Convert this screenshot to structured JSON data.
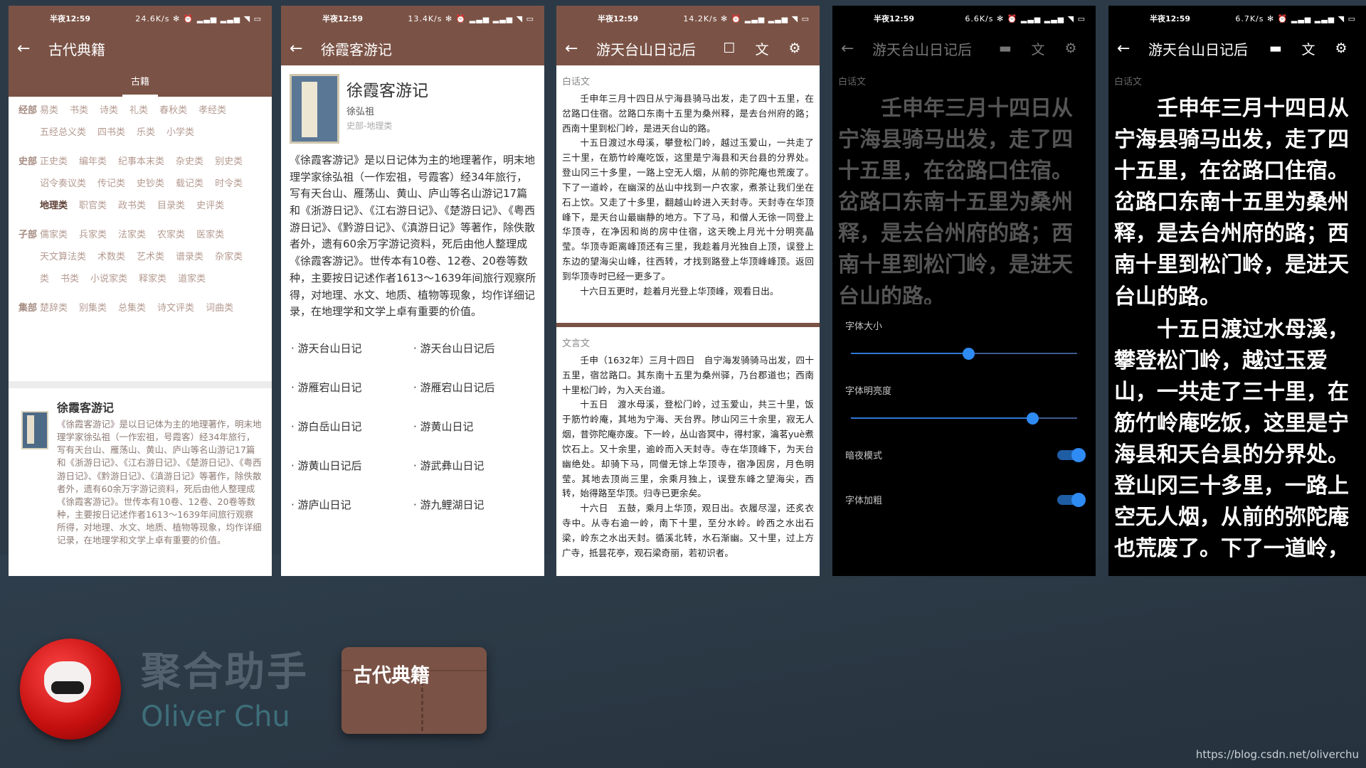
{
  "status": {
    "time": "半夜12:59",
    "p1_speed": "24.6K/s",
    "p2_speed": "13.4K/s",
    "p3_speed": "14.2K/s",
    "p4_speed": "6.6K/s",
    "p5_speed": "6.7K/s",
    "icons": "✻ ⏰ ▂▃▅ ▂▃▅ ◥ ▭"
  },
  "p1": {
    "title": "古代典籍",
    "tab": "古籍",
    "categories": [
      {
        "key": "经部",
        "items": [
          "易类",
          "书类",
          "诗类",
          "礼类",
          "春秋类",
          "孝经类",
          "五经总义类",
          "四书类",
          "乐类",
          "小学类"
        ]
      },
      {
        "key": "史部",
        "items": [
          "正史类",
          "编年类",
          "纪事本末类",
          "杂史类",
          "别史类",
          "诏令奏议类",
          "传记类",
          "史钞类",
          "载记类",
          "时令类",
          "地理类",
          "职官类",
          "政书类",
          "目录类",
          "史评类"
        ]
      },
      {
        "key": "子部",
        "items": [
          "儒家类",
          "兵家类",
          "法家类",
          "农家类",
          "医家类",
          "天文算法类",
          "术数类",
          "艺术类",
          "谱录类",
          "杂家类",
          "类",
          "书类",
          "小说家类",
          "释家类",
          "道家类"
        ]
      },
      {
        "key": "集部",
        "items": [
          "楚辞类",
          "别集类",
          "总集类",
          "诗文评类",
          "词曲类"
        ]
      }
    ],
    "selected": "地理类",
    "card_title": "徐霞客游记",
    "card_desc": "《徐霞客游记》是以日记体为主的地理著作，明末地理学家徐弘祖（一作宏祖，号霞客）经34年旅行，写有天台山、雁荡山、黄山、庐山等名山游记17篇和《浙游日记》、《江右游日记》、《楚游日记》、《粤西游日记》、《黔游日记》、《滇游日记》等著作，除佚散者外，遗有60余万字游记资料，死后由他人整理成《徐霞客游记》。世传本有10卷、12卷、20卷等数种，主要按日记述作者1613～1639年间旅行观察所得，对地理、水文、地质、植物等现象，均作详细记录，在地理学和文学上卓有重要的价值。"
  },
  "p2": {
    "title": "徐霞客游记",
    "book_title": "徐霞客游记",
    "author": "徐弘祖",
    "category": "史部-地理类",
    "desc": "《徐霞客游记》是以日记体为主的地理著作，明末地理学家徐弘祖（一作宏祖，号霞客）经34年旅行，写有天台山、雁荡山、黄山、庐山等名山游记17篇和《浙游日记》、《江右游日记》、《楚游日记》、《粤西游日记》、《黔游日记》、《滇游日记》等著作，除佚散者外，遗有60余万字游记资料，死后由他人整理成《徐霞客游记》。世传本有10卷、12卷、20卷等数种，主要按日记述作者1613～1639年间旅行观察所得，对地理、水文、地质、植物等现象，均作详细记录，在地理学和文学上卓有重要的价值。",
    "chapters": [
      "· 游天台山日记",
      "· 游天台山日记后",
      "· 游雁宕山日记",
      "· 游雁宕山日记后",
      "· 游白岳山日记",
      "· 游黄山日记",
      "· 游黄山日记后",
      "· 游武彝山日记",
      "· 游庐山日记",
      "· 游九鲤湖日记"
    ]
  },
  "p3": {
    "title": "游天台山日记后",
    "label_baihua": "白话文",
    "baihua": "壬申年三月十四日从宁海县骑马出发，走了四十五里，在岔路口住宿。岔路口东南十五里为桑州释，是去台州府的路；西南十里到松门岭，是进天台山的路。\n十五日渡过水母溪，攀登松门岭，越过玉爱山，一共走了三十里，在筋竹岭庵吃饭，这里是宁海县和天台县的分界处。登山冈三十多里，一路上空无人烟，从前的弥陀庵也荒废了。下了一道岭，在幽深的丛山中找到一户农家，煮茶让我们坐在石上饮。又走了十多里，翻越山岭进入天封寺。天封寺在华顶峰下，是天台山最幽静的地方。下了马，和僧人无徐一同登上华顶寺，在净因和尚的房中住宿，这天晚上月光十分明亮晶莹。华顶寺距离峰顶还有三里，我趁着月光独自上顶，误登上东边的望海尖山峰，往西转，才找到路登上华顶峰峰顶。返回到华顶寺时已经一更多了。\n十六日五更时，趁着月光登上华顶峰，观看日出。",
    "label_wenyan": "文言文",
    "wenyan": "壬申（1632年）三月十四日　自宁海发骑骑马出发，四十五里，宿岔路口。其东南十五里为桑州驿，乃台郡道也；西南十里松门岭，为入天台道。\n十五日　渡水母溪，登松门岭，过玉爱山，共三十里，饭于筋竹岭庵，其地为宁海、天台界。陟山冈三十余里，寂无人烟，昔弥陀庵亦废。下一岭，丛山沓冥中，得村家，瀹茗yuè煮饮石上。又十余里，逾岭而入天封寺。寺在华顶峰下，为天台幽绝处。却骑下马，同僧无馀上华顶寺，宿净因房，月色明莹。其地去顶尚三里，余乘月独上，误登东峰之望海尖，西转，始得路至华顶。归寺已更余矣。\n十六日　五鼓，乘月上华顶，观日出。衣履尽湿，还炙衣寺中。从寺右逾一岭，南下十里，至分水岭。岭西之水出石梁，岭东之水出天封。循溪北转，水石渐幽。又十里，过上方广寺，抵昙花亭，观石梁奇丽，若初识者。"
  },
  "p4": {
    "title": "游天台山日记后",
    "label": "白话文",
    "text": "壬申年三月十四日从宁海县骑马出发，走了四十五里，在岔路口住宿。岔路口东南十五里为桑州释，是去台州府的路；西南十里到松门岭，是进天台山的路。",
    "font_size_label": "字体大小",
    "font_size_value": 0.55,
    "brightness_label": "字体明亮度",
    "brightness_value": 0.85,
    "night_label": "暗夜模式",
    "bold_label": "字体加粗"
  },
  "p5": {
    "title": "游天台山日记后",
    "label": "白话文",
    "text1": "壬申年三月十四日从宁海县骑马出发，走了四十五里，在岔路口住宿。岔路口东南十五里为桑州释，是去台州府的路；西南十里到松门岭，是进天台山的路。",
    "text2": "十五日渡过水母溪，攀登松门岭，越过玉爱山，一共走了三十里，在筋竹岭庵吃饭，这里是宁海县和天台县的分界处。登山冈三十多里，一路上空无人烟，从前的弥陀庵也荒废了。下了一道岭，"
  },
  "brand": {
    "cn": "聚合助手",
    "en": "Oliver Chu",
    "app_icon_label": "古代典籍",
    "watermark": "https://blog.csdn.net/oliverchu"
  }
}
